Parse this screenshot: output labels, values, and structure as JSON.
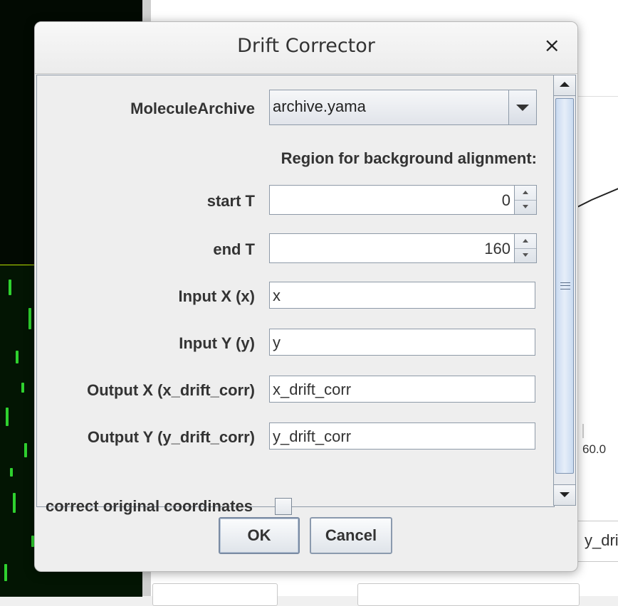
{
  "background": {
    "plot_tick_label": "60.0",
    "field_partial_text": "y_drif"
  },
  "dialog": {
    "title": "Drift Corrector",
    "close_glyph": "×",
    "fields": {
      "molecule_archive": {
        "label": "MoleculeArchive",
        "value": "archive.yama"
      },
      "section_label": "Region for background alignment:",
      "start_t": {
        "label": "start T",
        "value": "0"
      },
      "end_t": {
        "label": "end T",
        "value": "160"
      },
      "input_x": {
        "label": "Input X (x)",
        "value": "x"
      },
      "input_y": {
        "label": "Input Y (y)",
        "value": "y"
      },
      "output_x": {
        "label": "Output X (x_drift_corr)",
        "value": "x_drift_corr"
      },
      "output_y": {
        "label": "Output Y (y_drift_corr)",
        "value": "y_drift_corr"
      },
      "correct_original": {
        "label": "correct original coordinates",
        "checked": false
      }
    },
    "buttons": {
      "ok": "OK",
      "cancel": "Cancel"
    }
  }
}
